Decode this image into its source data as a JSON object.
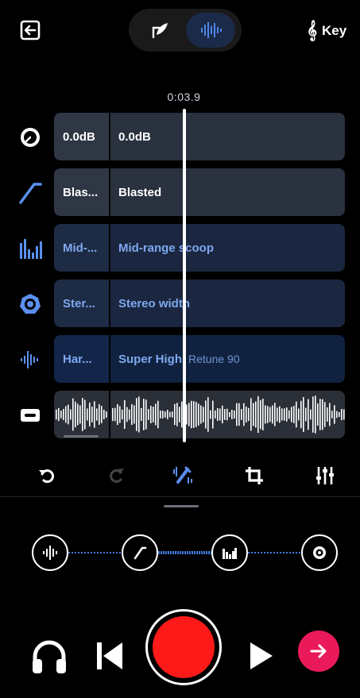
{
  "header": {
    "exit_icon": "exit-icon",
    "modes": [
      {
        "icon": "quill-icon",
        "active": false
      },
      {
        "icon": "waveform-icon",
        "active": true
      }
    ],
    "key_label": "Key",
    "key_icon": "treble-clef-icon"
  },
  "timeline": {
    "time": "0:03.9"
  },
  "tracks": [
    {
      "icon": "gauge-icon",
      "short": "0.0dB",
      "long": "0.0dB",
      "sub": ""
    },
    {
      "icon": "slope-icon",
      "short": "Blas...",
      "long": "Blasted",
      "sub": ""
    },
    {
      "icon": "eq-bars-icon",
      "short": "Mid-...",
      "long": "Mid-range scoop",
      "sub": ""
    },
    {
      "icon": "stereo-ring-icon",
      "short": "Ster...",
      "long": "Stereo width",
      "sub": ""
    },
    {
      "icon": "pitch-wave-icon",
      "short": "Har...",
      "long": "Super High",
      "sub": "Retune 90"
    },
    {
      "icon": "tape-icon",
      "short": "",
      "long": "",
      "sub": ""
    }
  ],
  "toolbar": [
    {
      "name": "undo-icon"
    },
    {
      "name": "redo-icon"
    },
    {
      "name": "magic-edit-icon"
    },
    {
      "name": "crop-icon"
    },
    {
      "name": "mixer-icon"
    }
  ],
  "chain": [
    {
      "name": "chain-pitch-icon"
    },
    {
      "name": "chain-slope-icon"
    },
    {
      "name": "chain-eq-icon"
    },
    {
      "name": "chain-stereo-icon"
    }
  ],
  "colors": {
    "accent": "#3f78e0",
    "record": "#ff1a1a",
    "next": "#ea1a5a"
  }
}
